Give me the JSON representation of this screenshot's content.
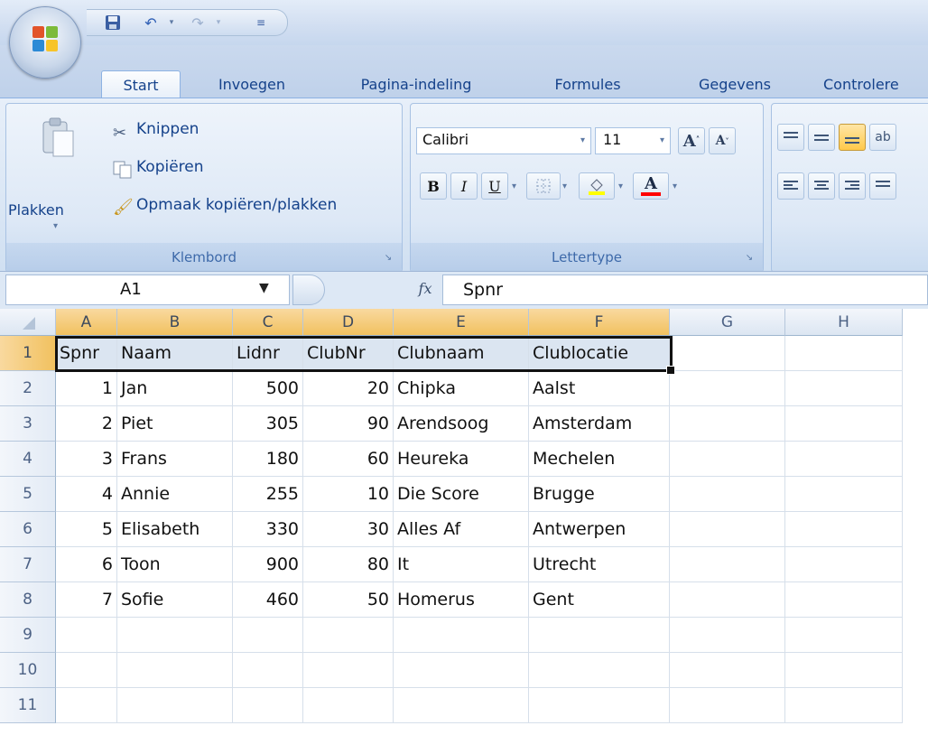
{
  "quick_access": {
    "save_icon": "save-icon",
    "undo_icon": "undo-icon",
    "redo_icon": "redo-icon",
    "customize_icon": "customize-qat-icon"
  },
  "tabs": [
    {
      "label": "Start",
      "active": true
    },
    {
      "label": "Invoegen"
    },
    {
      "label": "Pagina-indeling"
    },
    {
      "label": "Formules"
    },
    {
      "label": "Gegevens"
    },
    {
      "label": "Controlere"
    }
  ],
  "ribbon": {
    "clipboard": {
      "label": "Klembord",
      "paste": "Plakken",
      "cut": "Knippen",
      "copy": "Kopiëren",
      "format_painter": "Opmaak kopiëren/plakken"
    },
    "font": {
      "label": "Lettertype",
      "font_name": "Calibri",
      "font_size": "11",
      "bold": "B",
      "italic": "I",
      "underline": "U",
      "font_color_glyph": "A"
    }
  },
  "formula_bar": {
    "name_box": "A1",
    "fx": "fx",
    "value": "Spnr"
  },
  "columns": [
    "A",
    "B",
    "C",
    "D",
    "E",
    "F",
    "G",
    "H"
  ],
  "rows": [
    "1",
    "2",
    "3",
    "4",
    "5",
    "6",
    "7",
    "8",
    "9",
    "10",
    "11"
  ],
  "table": {
    "header": [
      "Spnr",
      "Naam",
      "Lidnr",
      "ClubNr",
      "Clubnaam",
      "Clublocatie"
    ],
    "rows": [
      [
        "1",
        "Jan",
        "500",
        "20",
        "Chipka",
        "Aalst"
      ],
      [
        "2",
        "Piet",
        "305",
        "90",
        "Arendsoog",
        "Amsterdam"
      ],
      [
        "3",
        "Frans",
        "180",
        "60",
        "Heureka",
        "Mechelen"
      ],
      [
        "4",
        "Annie",
        "255",
        "10",
        "Die Score",
        "Brugge"
      ],
      [
        "5",
        "Elisabeth",
        "330",
        "30",
        "Alles Af",
        "Antwerpen"
      ],
      [
        "6",
        "Toon",
        "900",
        "80",
        "It",
        "Utrecht"
      ],
      [
        "7",
        "Sofie",
        "460",
        "50",
        "Homerus",
        "Gent"
      ]
    ]
  },
  "colors": {
    "selection_header": "#f1c15f",
    "ribbon_text": "#15428b",
    "highlight": "#ffff00",
    "font_red": "#ff0000"
  }
}
